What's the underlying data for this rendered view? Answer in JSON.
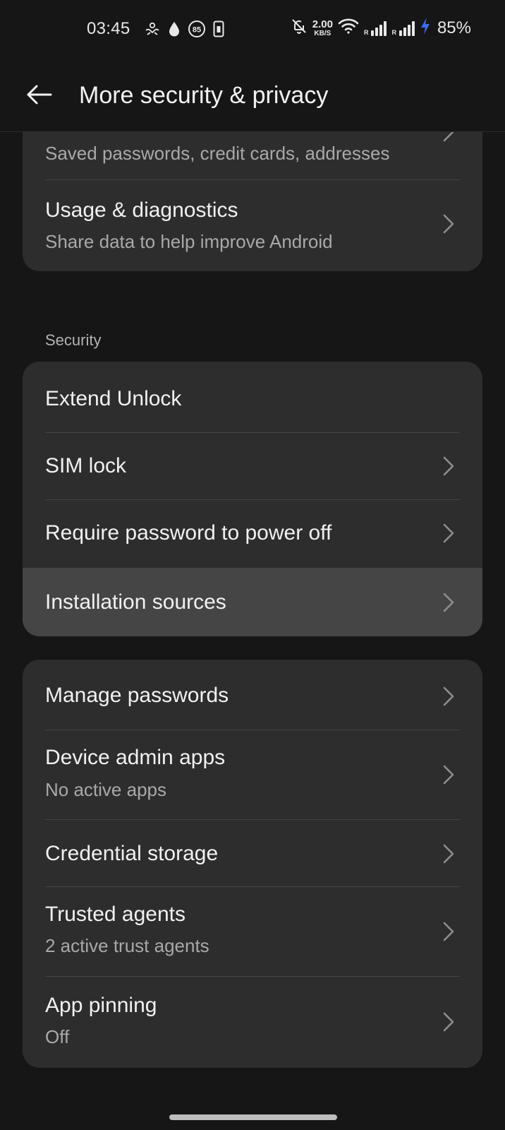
{
  "status_bar": {
    "time": "03:45",
    "left_icons": [
      "hands-icon",
      "water-drop-icon",
      "badge-85-icon",
      "phone-screen-icon"
    ],
    "badge_number": "85",
    "net_speed_value": "2.00",
    "net_speed_unit": "KB/S",
    "roaming_label": "R",
    "battery": "85%"
  },
  "header": {
    "title": "More security & privacy"
  },
  "privacy_card": {
    "items": [
      {
        "subtitle": "Saved passwords, credit cards, addresses"
      },
      {
        "title": "Usage & diagnostics",
        "subtitle": "Share data to help improve Android"
      }
    ]
  },
  "security_section": {
    "label": "Security",
    "items": [
      {
        "title": "Extend Unlock"
      },
      {
        "title": "SIM lock"
      },
      {
        "title": "Require password to power off"
      },
      {
        "title": "Installation sources"
      }
    ]
  },
  "credentials_card": {
    "items": [
      {
        "title": "Manage passwords"
      },
      {
        "title": "Device admin apps",
        "subtitle": "No active apps"
      },
      {
        "title": "Credential storage"
      },
      {
        "title": "Trusted agents",
        "subtitle": "2 active trust agents"
      },
      {
        "title": "App pinning",
        "subtitle": "Off"
      }
    ]
  },
  "colors": {
    "background": "#161616",
    "card": "#2d2d2d",
    "highlight": "#454545",
    "charging_bolt": "#3b6cf5"
  }
}
